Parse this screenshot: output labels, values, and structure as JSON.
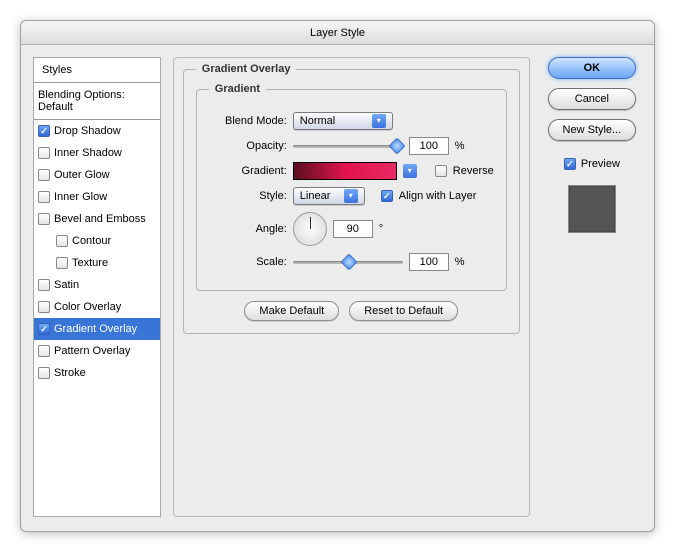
{
  "title": "Layer Style",
  "styles": {
    "header": "Styles",
    "blending": "Blending Options: Default",
    "items": [
      {
        "label": "Drop Shadow",
        "checked": true
      },
      {
        "label": "Inner Shadow",
        "checked": false
      },
      {
        "label": "Outer Glow",
        "checked": false
      },
      {
        "label": "Inner Glow",
        "checked": false
      },
      {
        "label": "Bevel and Emboss",
        "checked": false
      },
      {
        "label": "Contour",
        "checked": false,
        "indent": true
      },
      {
        "label": "Texture",
        "checked": false,
        "indent": true
      },
      {
        "label": "Satin",
        "checked": false
      },
      {
        "label": "Color Overlay",
        "checked": false
      },
      {
        "label": "Gradient Overlay",
        "checked": true,
        "selected": true
      },
      {
        "label": "Pattern Overlay",
        "checked": false
      },
      {
        "label": "Stroke",
        "checked": false
      }
    ]
  },
  "panel": {
    "group_title": "Gradient Overlay",
    "sub_title": "Gradient",
    "blend_mode_label": "Blend Mode:",
    "blend_mode_value": "Normal",
    "opacity_label": "Opacity:",
    "opacity_value": "100",
    "opacity_unit": "%",
    "gradient_label": "Gradient:",
    "reverse_label": "Reverse",
    "reverse_checked": false,
    "style_label": "Style:",
    "style_value": "Linear",
    "align_label": "Align with Layer",
    "align_checked": true,
    "angle_label": "Angle:",
    "angle_value": "90",
    "angle_unit": "°",
    "scale_label": "Scale:",
    "scale_value": "100",
    "scale_unit": "%",
    "make_default": "Make Default",
    "reset_default": "Reset to Default"
  },
  "buttons": {
    "ok": "OK",
    "cancel": "Cancel",
    "new_style": "New Style...",
    "preview": "Preview",
    "preview_checked": true
  }
}
